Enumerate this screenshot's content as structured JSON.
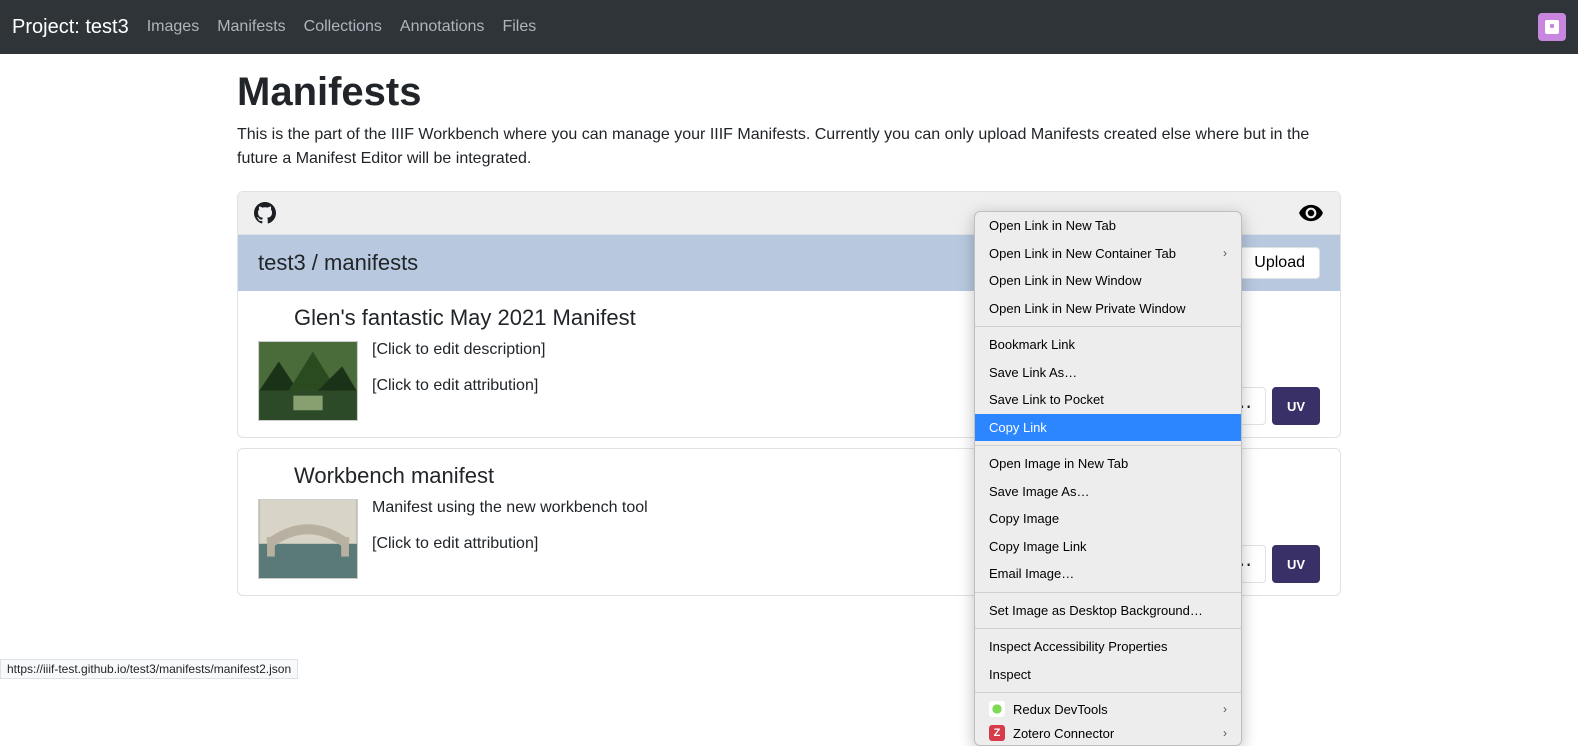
{
  "nav": {
    "project_label": "Project: test3",
    "links": [
      "Images",
      "Manifests",
      "Collections",
      "Annotations",
      "Files"
    ]
  },
  "page": {
    "title": "Manifests",
    "intro": "This is the part of the IIIF Workbench where you can manage your IIIF Manifests. Currently you can only upload Manifests created else where but in the future a Manifest Editor will be integrated."
  },
  "breadcrumb": {
    "text": "test3 / manifests",
    "upload_label": "Upload"
  },
  "cards": [
    {
      "title": "Glen's fantastic May 2021 Manifest",
      "desc": "[Click to edit description]",
      "attr": "[Click to edit attribution]",
      "uv": "UV"
    },
    {
      "title": "Workbench manifest",
      "desc": "Manifest using the new workbench tool",
      "attr": "[Click to edit attribution]",
      "uv": "UV"
    }
  ],
  "context_menu": {
    "g1": [
      "Open Link in New Tab",
      "Open Link in New Container Tab",
      "Open Link in New Window",
      "Open Link in New Private Window"
    ],
    "g2": [
      "Bookmark Link",
      "Save Link As…",
      "Save Link to Pocket"
    ],
    "highlight": "Copy Link",
    "g3": [
      "Open Image in New Tab",
      "Save Image As…",
      "Copy Image",
      "Copy Image Link",
      "Email Image…"
    ],
    "g4": [
      "Set Image as Desktop Background…"
    ],
    "g5": [
      "Inspect Accessibility Properties",
      "Inspect"
    ],
    "ext": [
      "Redux DevTools",
      "Zotero Connector"
    ]
  },
  "status_url": "https://iiif-test.github.io/test3/manifests/manifest2.json"
}
